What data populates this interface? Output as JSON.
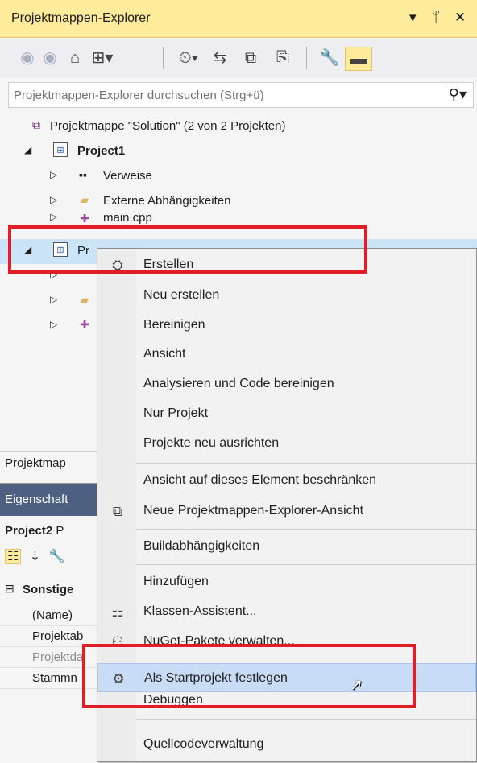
{
  "solution_explorer": {
    "title": "Projektmappen-Explorer",
    "title_controls": [
      "▾",
      "ᛘ",
      "✕"
    ],
    "search_placeholder": "Projektmappen-Explorer durchsuchen (Strg+ü)",
    "tree": {
      "solution_label": "Projektmappe \"Solution\" (2 von 2 Projekten)",
      "project1_label": "Project1",
      "verweise_label": "Verweise",
      "externe_label": "Externe Abhängigkeiten",
      "main_cpp_label": "main.cpp",
      "project2_label_partial": "Pr"
    },
    "bottom_tab_label": "Projektmap"
  },
  "properties": {
    "title": "Eigenschaft",
    "object_label": "Project2",
    "object_suffix": "P",
    "category_label": "Sonstige",
    "rows": [
      "(Name)",
      "Projektab",
      "Projektda",
      "Stammn"
    ]
  },
  "context_menu": {
    "items": {
      "erstellen": "Erstellen",
      "neu_erstellen": "Neu erstellen",
      "bereinigen": "Bereinigen",
      "ansicht": "Ansicht",
      "analysieren": "Analysieren und Code bereinigen",
      "nur_projekt": "Nur Projekt",
      "neu_ausrichten": "Projekte neu ausrichten",
      "beschraenken": "Ansicht auf dieses Element beschränken",
      "neue_ansicht": "Neue Projektmappen-Explorer-Ansicht",
      "buildabh": "Buildabhängigkeiten",
      "hinzufuegen": "Hinzufügen",
      "klassen": "Klassen-Assistent...",
      "nuget": "NuGet-Pakete verwalten...",
      "startprojekt": "Als Startprojekt festlegen",
      "debuggen": "Debuggen",
      "quellcode": "Quellcodeverwaltung"
    }
  },
  "colors": {
    "title_active": "#ffeb9c",
    "highlight_box": "#e31d28",
    "menu_hover": "#c9dcf5"
  }
}
